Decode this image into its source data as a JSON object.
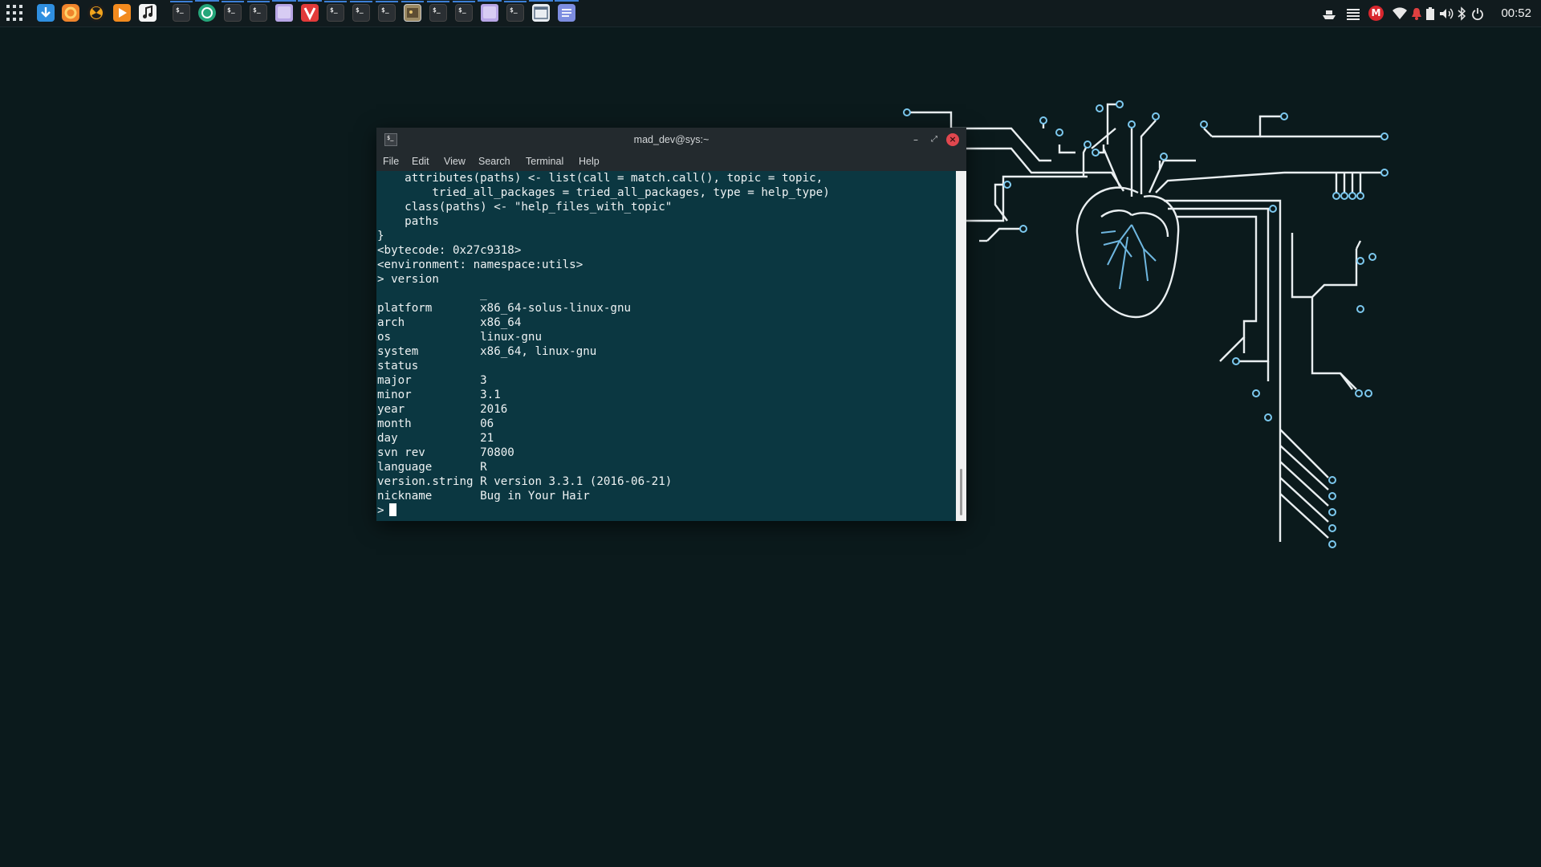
{
  "panel": {
    "clock": "00:52",
    "taskbar_icons": [
      "apps-grid-icon",
      "download-icon",
      "firefox-icon",
      "radiation-icon",
      "play-icon",
      "music-icon",
      "terminal-icon",
      "chat-icon",
      "terminal-icon",
      "terminal-icon",
      "folder-icon",
      "vivaldi-icon",
      "terminal-icon",
      "terminal-icon",
      "terminal-icon",
      "image-viewer-icon",
      "terminal-icon",
      "terminal-icon",
      "folder-icon",
      "terminal-icon",
      "window-icon",
      "text-editor-icon"
    ],
    "tray_icons": [
      "ship-icon",
      "stripes-icon",
      "mega-icon",
      "wifi-icon",
      "notification-icon",
      "battery-icon",
      "volume-icon",
      "bluetooth-icon",
      "power-icon"
    ],
    "mega_label": "M"
  },
  "terminal": {
    "title": "mad_dev@sys:~",
    "icon_text": "$_",
    "menu": [
      "File",
      "Edit",
      "View",
      "Search",
      "Terminal",
      "Help"
    ],
    "lines": [
      "    attributes(paths) <- list(call = match.call(), topic = topic,",
      "        tried_all_packages = tried_all_packages, type = help_type)",
      "    class(paths) <- \"help_files_with_topic\"",
      "    paths",
      "}",
      "<bytecode: 0x27c9318>",
      "<environment: namespace:utils>",
      "> version",
      "               _",
      "platform       x86_64-solus-linux-gnu",
      "arch           x86_64",
      "os             linux-gnu",
      "system         x86_64, linux-gnu",
      "status",
      "major          3",
      "minor          3.1",
      "year           2016",
      "month          06",
      "day            21",
      "svn rev        70800",
      "language       R",
      "version.string R version 3.3.1 (2016-06-21)",
      "nickname       Bug in Your Hair"
    ],
    "prompt": ">",
    "colors": {
      "background": "#0b3741",
      "text": "#eef2f3",
      "close": "#e0474e"
    }
  },
  "desktop": {
    "background": "#0b1a1c",
    "wallpaper": "circuit-heart",
    "accent": "#6fb7e0"
  }
}
